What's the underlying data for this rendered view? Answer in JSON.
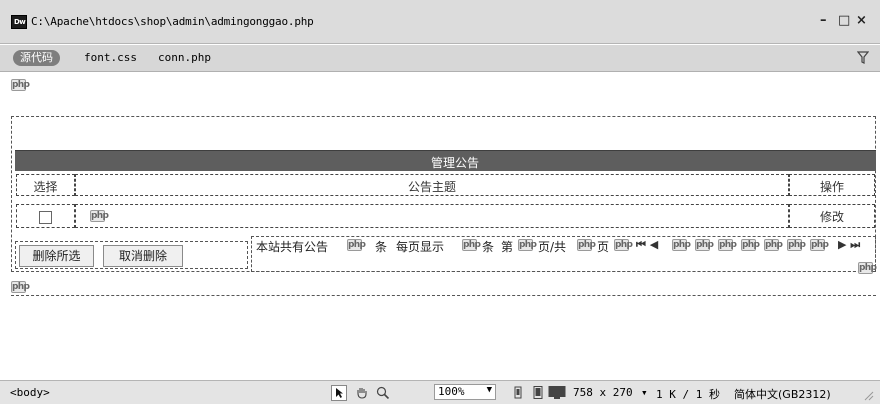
{
  "window": {
    "file_path": "C:\\Apache\\htdocs\\shop\\admin\\admingonggao.php",
    "app_icon_label": "Dw",
    "minimize_label": "–",
    "maximize_label": "□",
    "close_label": "×"
  },
  "related_files": {
    "source_label": "源代码",
    "files": [
      "font.css",
      "conn.php"
    ]
  },
  "canvas": {
    "php_marker": "php",
    "table_title": "管理公告",
    "columns": {
      "select": "选择",
      "subject": "公告主题",
      "action": "操作"
    },
    "row_action": "修改",
    "buttons": {
      "delete_selected": "删除所选",
      "cancel_delete": "取消删除"
    },
    "pager": {
      "total_prefix": "本站共有公告",
      "unit_item": "条",
      "per_page": "每页显示",
      "unit_item2": "条",
      "page_prefix": "第",
      "page_of": "页/共",
      "page_suffix": "页",
      "first_prev": "⏮ ◀",
      "next_last": "▶ ⏭"
    }
  },
  "statusbar": {
    "tag_selector": "<body>",
    "zoom": "100%",
    "dimensions": "758 x 270",
    "dim_dropdown": "▾",
    "file_size": "1 K / 1 秒",
    "encoding": "简体中文(GB2312)"
  }
}
